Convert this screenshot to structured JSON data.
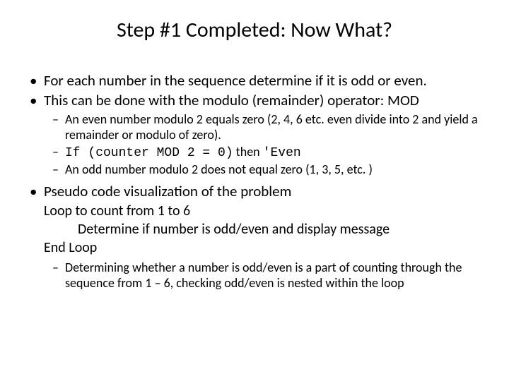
{
  "title": "Step #1 Completed: Now What?",
  "b1": "For each number in the sequence determine if it is odd or even.",
  "b2": "This can be done with the modulo (remainder) operator: MOD",
  "s1": "An even number modulo 2 equals zero (2, 4, 6 etc. even divide into 2 and yield a remainder or modulo of zero).",
  "s2a": "If (counter MOD 2 = 0)",
  "s2b": " then ",
  "s2c": "'Even",
  "s3": "An odd number modulo 2 does not equal zero (1, 3, 5, etc. )",
  "b3": "Pseudo code visualization of the problem",
  "p1": "Loop to count from 1 to 6",
  "p2": "Determine if number is odd/even and display message",
  "p3": "End Loop",
  "s4": "Determining whether a number is odd/even is a part of counting through the sequence from 1 – 6, checking odd/even is nested within the loop"
}
